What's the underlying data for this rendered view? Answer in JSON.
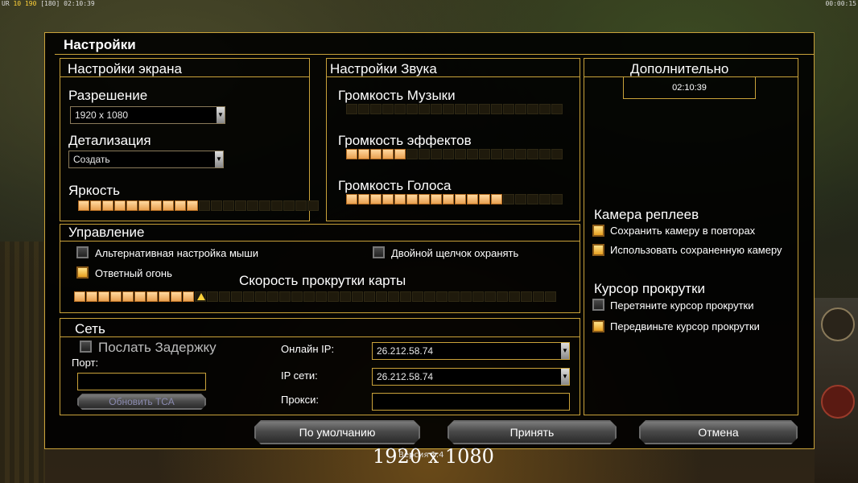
{
  "hud": {
    "left_a": "UR",
    "left_b": "10",
    "left_c": "190",
    "left_d": "[180]",
    "left_time": "02:10:39",
    "right_time": "00:00:15"
  },
  "dialog": {
    "title": "Настройки"
  },
  "screen": {
    "title": "Настройки экрана",
    "resolution_label": "Разрешение",
    "resolution_value": "1920 x 1080",
    "detail_label": "Детализация",
    "detail_value": "Создать",
    "brightness_label": "Яркость",
    "brightness_level": "10/20"
  },
  "sound": {
    "title": "Настройки Звука",
    "music_label": "Громкость Музыки",
    "music_level": "0/18",
    "effects_label": "Громкость эффектов",
    "effects_level": "5/18",
    "voice_label": "Громкость Голоса",
    "voice_level": "13/18"
  },
  "extra": {
    "title": "Дополнительно",
    "clock": "02:10:39",
    "replay_camera_title": "Камера реплеев",
    "replay_save": "Сохранить камеру в повторах",
    "replay_use": "Использовать сохраненную камеру",
    "scroll_cursor_title": "Курсор прокрутки",
    "scroll_drag": "Перетяните курсор прокрутки",
    "scroll_move": "Передвиньте курсор прокрутки"
  },
  "control": {
    "title": "Управление",
    "alt_mouse": "Альтернативная настройка мыши",
    "double_click": "Двойной щелчок охранять",
    "return_fire": "Ответный огонь",
    "scroll_speed_label": "Скорость прокрутки карты",
    "scroll_speed_level": "10/40"
  },
  "network": {
    "title": "Сеть",
    "send_delay": "Послать Задержку",
    "port_label": "Порт:",
    "port_value": "",
    "refresh_button": "Обновить ТСА",
    "online_ip_label": "Онлайн IP:",
    "online_ip_value": "26.212.58.74",
    "lan_ip_label": "IP сети:",
    "lan_ip_value": "26.212.58.74",
    "proxy_label": "Прокси:",
    "proxy_value": ""
  },
  "buttons": {
    "defaults": "По умолчанию",
    "accept": "Принять",
    "cancel": "Отмена"
  },
  "footer": {
    "version": "Версия 1.4",
    "overlay_resolution": "1920 x 1080"
  },
  "colors": {
    "gold": "#c9a23a",
    "seg_on": "#e8a050",
    "seg_off": "#1f1a0c"
  }
}
